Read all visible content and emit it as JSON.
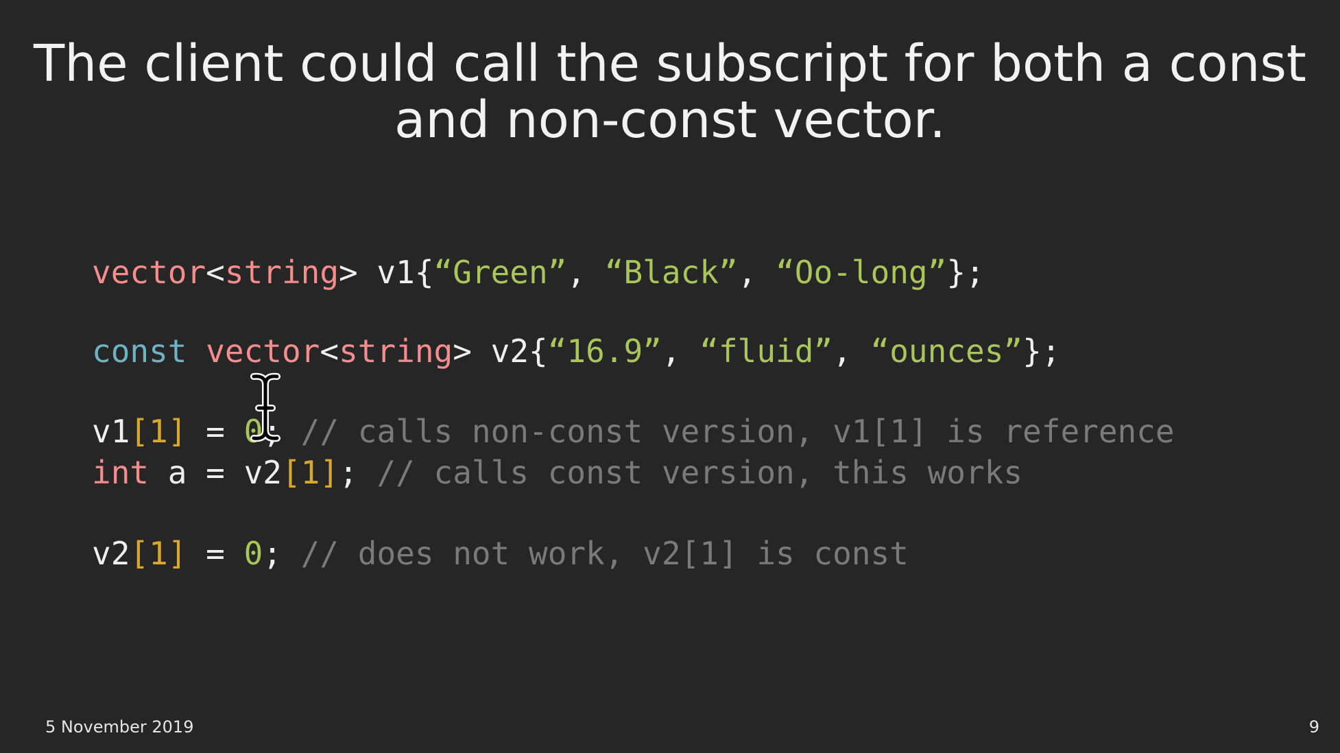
{
  "slide": {
    "title": "The client could call the subscript for both a const and non-const vector.",
    "date": "5 November 2019",
    "page_number": "9"
  },
  "code": {
    "line1": {
      "t1": "vector",
      "t2": "<",
      "t3": "string",
      "t4": "> v1{",
      "s1": "“Green”",
      "p1": ", ",
      "s2": "“Black”",
      "p2": ", ",
      "s3": "“Oo-long”",
      "p3": "};"
    },
    "line2": {
      "kw": "const",
      "sp": " ",
      "t1": "vector",
      "t2": "<",
      "t3": "string",
      "t4": "> v2{",
      "s1": "“16.9”",
      "p1": ", ",
      "s2": "“fluid”",
      "p2": ", ",
      "s3": "“ounces”",
      "p3": "};"
    },
    "line3": {
      "var": "v1",
      "idx": "[1]",
      "op": " = ",
      "num": "0",
      "semi": "; ",
      "cmt": "// calls non-const version, v1[1] is reference"
    },
    "line4": {
      "kw": "int",
      "mid": " a = v2",
      "idx": "[1]",
      "semi": "; ",
      "cmt": "// calls const version, this works"
    },
    "line5": {
      "var": "v2",
      "idx": "[1]",
      "op": " = ",
      "num": "0",
      "semi": "; ",
      "cmt": "// does not work, v2[1] is const"
    }
  },
  "colors": {
    "background": "#262626",
    "type": "#f58d8d",
    "keyword_const": "#6fb2c4",
    "string": "#a8c65a",
    "bracket": "#d7a72f",
    "comment": "#7a7a7a",
    "text": "#efefef"
  },
  "icons": {
    "cursor": "text-cursor-ibeam-icon"
  }
}
